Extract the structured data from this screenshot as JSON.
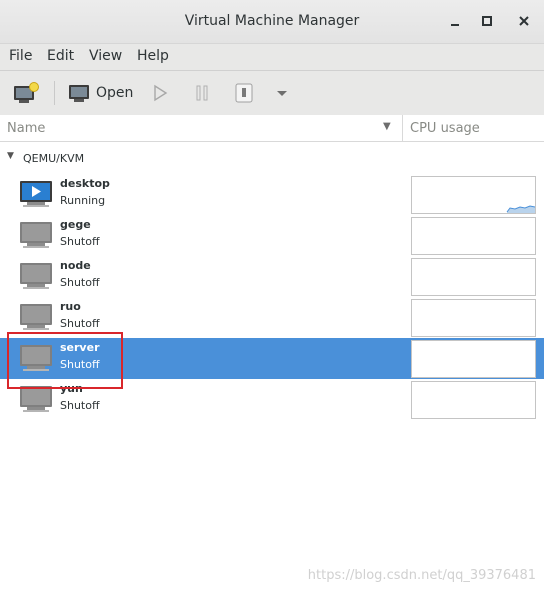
{
  "window": {
    "title": "Virtual Machine Manager"
  },
  "menubar": {
    "items": [
      "File",
      "Edit",
      "View",
      "Help"
    ]
  },
  "toolbar": {
    "open_label": "Open"
  },
  "columns": {
    "name": "Name",
    "cpu": "CPU usage"
  },
  "connection": {
    "label": "QEMU/KVM"
  },
  "vms": [
    {
      "name": "desktop",
      "status": "Running",
      "selected": false
    },
    {
      "name": "gege",
      "status": "Shutoff",
      "selected": false
    },
    {
      "name": "node",
      "status": "Shutoff",
      "selected": false
    },
    {
      "name": "ruo",
      "status": "Shutoff",
      "selected": false
    },
    {
      "name": "server",
      "status": "Shutoff",
      "selected": true
    },
    {
      "name": "yun",
      "status": "Shutoff",
      "selected": false
    }
  ],
  "watermark": "https://blog.csdn.net/qq_39376481",
  "colors": {
    "selection": "#4a90d9",
    "annotation": "#d9262b"
  }
}
